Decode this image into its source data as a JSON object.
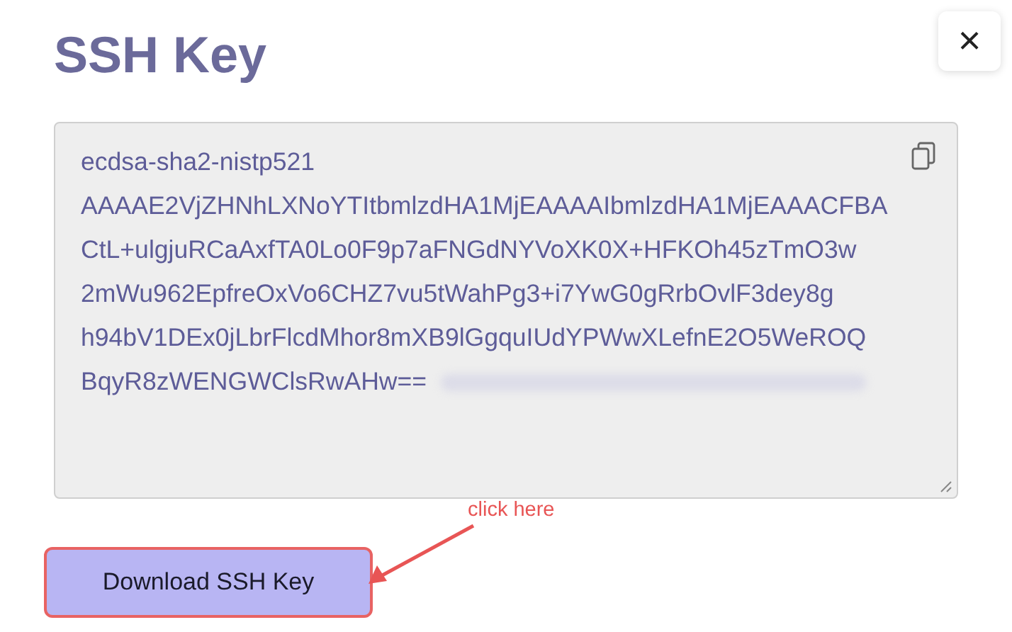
{
  "title": "SSH Key",
  "close_button": "×",
  "key_lines": [
    "ecdsa-sha2-nistp521",
    "AAAAE2VjZHNhLXNoYTItbmlzdHA1MjEAAAAIbmlzdHA1MjEAAACFBA",
    "CtL+ulgjuRCaAxfTA0Lo0F9p7aFNGdNYVoXK0X+HFKOh45zTmO3w",
    "2mWu962EpfreOxVo6CHZ7vu5tWahPg3+i7YwG0gRrbOvlF3dey8g",
    "h94bV1DEx0jLbrFlcdMhor8mXB9lGgquIUdYPWwXLefnE2O5WeROQ",
    "BqyR8zWENGWClsRwAHw=="
  ],
  "download_button": "Download SSH Key",
  "annotation": "click here"
}
